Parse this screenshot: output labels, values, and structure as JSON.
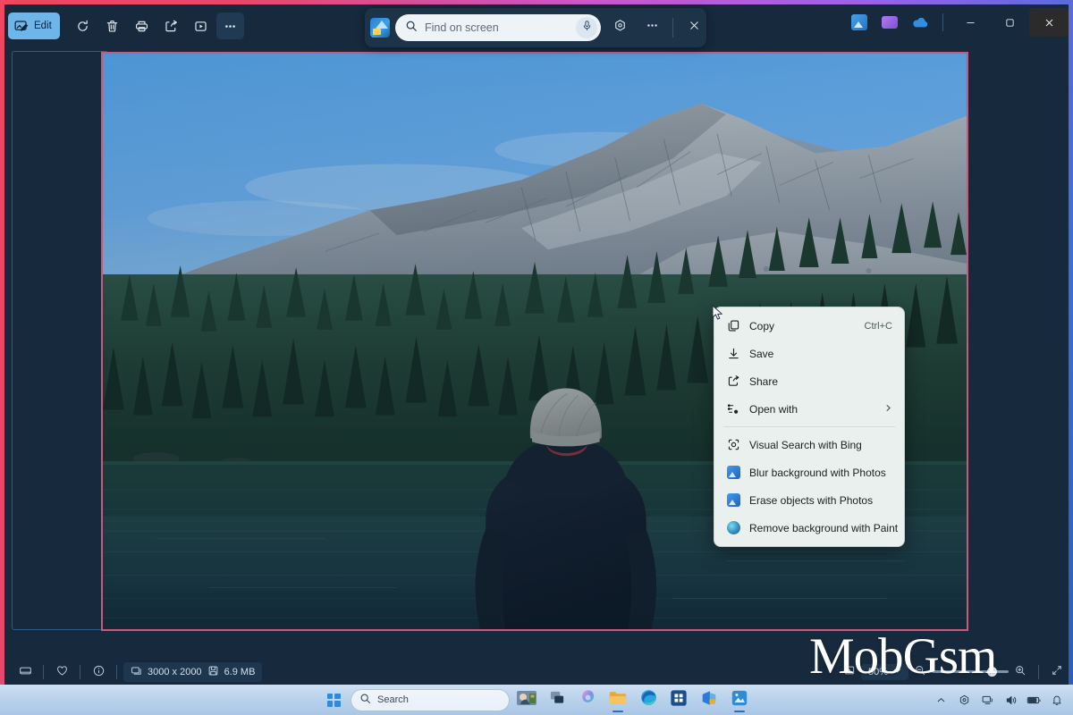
{
  "app": {
    "name": "Photos",
    "toolbar": {
      "edit_label": "Edit",
      "items": [
        {
          "name": "edit",
          "label": "Edit",
          "icon": "edit-image-icon"
        },
        {
          "name": "rotate",
          "label": "Rotate",
          "icon": "rotate-icon"
        },
        {
          "name": "delete",
          "label": "Delete",
          "icon": "trash-icon"
        },
        {
          "name": "print",
          "label": "Print",
          "icon": "printer-icon"
        },
        {
          "name": "share",
          "label": "Share",
          "icon": "share-icon"
        },
        {
          "name": "slideshow",
          "label": "Slideshow",
          "icon": "play-box-icon"
        },
        {
          "name": "more",
          "label": "See more",
          "icon": "ellipsis-icon"
        }
      ]
    },
    "caption": {
      "minimize_label": "Minimize",
      "maximize_label": "Maximize",
      "close_label": "Close",
      "tray_apps": [
        "photos-app-icon",
        "purple-app-icon",
        "onedrive-cloud-icon"
      ]
    }
  },
  "find_bar": {
    "app_icon": "find-on-screen-icon",
    "search_icon": "search-icon",
    "placeholder": "Find on screen",
    "value": "",
    "mic_icon": "microphone-icon",
    "copilot_icon": "copilot-icon",
    "more_icon": "ellipsis-icon",
    "close_icon": "close-icon"
  },
  "photo": {
    "alt": "Person in dark jacket and gray beanie standing at a mountain lake",
    "dimensions": "3000 x 2000",
    "file_size": "6.9 MB"
  },
  "context_menu": {
    "items": [
      {
        "label": "Copy",
        "accel": "Ctrl+C",
        "icon": "copy-icon",
        "submenu": false
      },
      {
        "label": "Save",
        "accel": "",
        "icon": "save-download-icon",
        "submenu": false
      },
      {
        "label": "Share",
        "accel": "",
        "icon": "share-icon",
        "submenu": false
      },
      {
        "label": "Open with",
        "accel": "",
        "icon": "open-with-icon",
        "submenu": true
      },
      {
        "label": "Visual Search with Bing",
        "accel": "",
        "icon": "visual-search-icon",
        "submenu": false
      },
      {
        "label": "Blur background with Photos",
        "accel": "",
        "icon": "photos-app-icon",
        "submenu": false
      },
      {
        "label": "Erase objects with Photos",
        "accel": "",
        "icon": "photos-app-icon",
        "submenu": false
      },
      {
        "label": "Remove background with Paint",
        "accel": "",
        "icon": "paint-app-icon",
        "submenu": false
      }
    ],
    "separator_after_index": 3
  },
  "status_bar": {
    "gallery_icon": "filmstrip-icon",
    "favorite_icon": "heart-icon",
    "info_icon": "info-icon",
    "dimensions_icon": "image-size-icon",
    "dimensions": "3000 x 2000",
    "file_size_icon": "disk-icon",
    "file_size": "6.9 MB",
    "fit_icon": "fit-to-window-icon",
    "zoom_percent": "50%",
    "zoom_dropdown_icon": "chevron-down-icon",
    "zoom_out_icon": "zoom-out-icon",
    "zoom_in_icon": "zoom-in-icon",
    "fullscreen_icon": "fullscreen-icon"
  },
  "watermark": {
    "text": "MobGsm"
  },
  "taskbar": {
    "start_label": "Start",
    "search_icon": "search-icon",
    "search_placeholder": "Search",
    "search_value": "",
    "apps": [
      {
        "name": "widgets-weather-icon",
        "label": "Widgets"
      },
      {
        "name": "task-view-icon",
        "label": "Task View"
      },
      {
        "name": "copilot-icon",
        "label": "Copilot"
      },
      {
        "name": "file-explorer-icon",
        "label": "File Explorer"
      },
      {
        "name": "edge-browser-icon",
        "label": "Microsoft Edge"
      },
      {
        "name": "microsoft-store-icon",
        "label": "Microsoft Store"
      },
      {
        "name": "office-icon",
        "label": "Microsoft 365"
      },
      {
        "name": "photos-app-icon",
        "label": "Photos"
      }
    ],
    "tray": [
      {
        "name": "show-hidden-icons",
        "label": "Show hidden icons"
      },
      {
        "name": "copilot-icon",
        "label": "Copilot"
      },
      {
        "name": "network-icon",
        "label": "Network"
      },
      {
        "name": "volume-icon",
        "label": "Volume"
      },
      {
        "name": "battery-icon",
        "label": "Battery"
      },
      {
        "name": "notification-icon",
        "label": "Notifications"
      }
    ]
  },
  "colors": {
    "frame_gradient_start": "#f0465f",
    "frame_gradient_end": "#2b5fb8",
    "app_background": "#16293d",
    "accent_edit": "#6fb6e8",
    "photo_border": "#c85b7d",
    "menu_background": "#eaf0ee"
  }
}
